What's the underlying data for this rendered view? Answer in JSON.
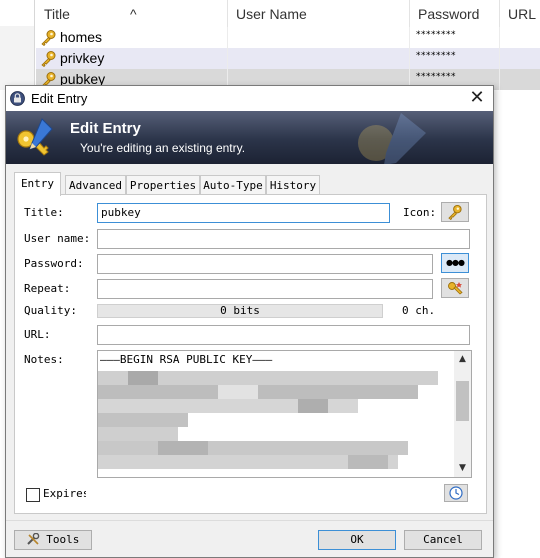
{
  "list": {
    "columns": [
      {
        "label": "Title"
      },
      {
        "label": "User Name"
      },
      {
        "label": "Password"
      },
      {
        "label": "URL"
      }
    ],
    "sort_indicator": "^",
    "rows": [
      {
        "title": "homes",
        "user": "",
        "password": "********",
        "url": ""
      },
      {
        "title": "privkey",
        "user": "",
        "password": "********",
        "url": ""
      },
      {
        "title": "pubkey",
        "user": "",
        "password": "********",
        "url": ""
      }
    ]
  },
  "dialog": {
    "window_title": "Edit Entry",
    "close_glyph": "✕",
    "banner_title": "Edit Entry",
    "banner_subtitle": "You're editing an existing entry.",
    "tabs": [
      "Entry",
      "Advanced",
      "Properties",
      "Auto-Type",
      "History"
    ],
    "active_tab": "Entry",
    "labels": {
      "title": "Title:",
      "icon": "Icon:",
      "user_name": "User name:",
      "password": "Password:",
      "repeat": "Repeat:",
      "quality": "Quality:",
      "url": "URL:",
      "notes": "Notes:",
      "expires": "Expires"
    },
    "values": {
      "title": "pubkey",
      "user_name": "",
      "password": "",
      "repeat": "",
      "url": "",
      "quality_bits": "0 bits",
      "quality_chars": "0 ch.",
      "notes_first_line": "———BEGIN RSA PUBLIC KEY———"
    },
    "show_password_glyph": "●●●",
    "buttons": {
      "tools": "Tools",
      "ok": "OK",
      "cancel": "Cancel"
    }
  },
  "colors": {
    "banner_dark": "#1c2233",
    "focus_blue": "#3c8fd6",
    "selected_row": "#e8e8f4",
    "key_gold": "#d9a21b"
  }
}
